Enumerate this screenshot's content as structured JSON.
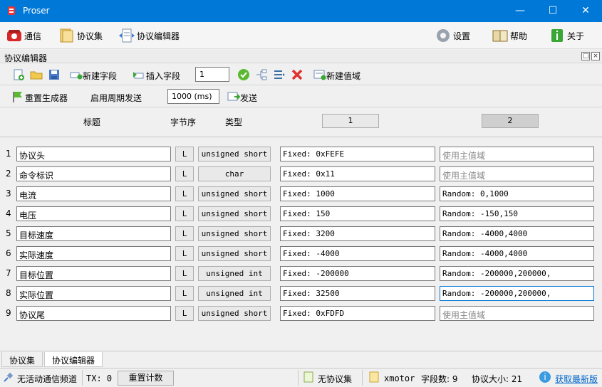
{
  "window": {
    "title": "Proser"
  },
  "toolbar": {
    "comm": "通信",
    "protocol_set": "协议集",
    "protocol_editor": "协议编辑器",
    "settings": "设置",
    "help": "帮助",
    "about": "关于"
  },
  "panel": {
    "title": "协议编辑器"
  },
  "editor_toolbar": {
    "new_field": "新建字段",
    "insert_field": "插入字段",
    "insert_count": "1",
    "new_value_domain": "新建值域"
  },
  "period_toolbar": {
    "reset_generator": "重置生成器",
    "enable_periodic": "启用周期发送",
    "period": "1000 (ms)",
    "send": "发送"
  },
  "columns": {
    "title": "标题",
    "byte_order": "字节序",
    "type": "类型",
    "domain1": "1",
    "domain2": "2"
  },
  "rows": [
    {
      "num": "1",
      "title": "协议头",
      "order": "L",
      "type": "unsigned short",
      "d1": "Fixed: 0xFEFE",
      "d2": "使用主值域",
      "d2_placeholder": true
    },
    {
      "num": "2",
      "title": "命令标识",
      "order": "L",
      "type": "char",
      "d1": "Fixed: 0x11",
      "d2": "使用主值域",
      "d2_placeholder": true
    },
    {
      "num": "3",
      "title": "电流",
      "order": "L",
      "type": "unsigned short",
      "d1": "Fixed: 1000",
      "d2": "Random: 0,1000",
      "d2_placeholder": false
    },
    {
      "num": "4",
      "title": "电压",
      "order": "L",
      "type": "unsigned short",
      "d1": "Fixed: 150",
      "d2": "Random: -150,150",
      "d2_placeholder": false
    },
    {
      "num": "5",
      "title": "目标速度",
      "order": "L",
      "type": "unsigned short",
      "d1": "Fixed: 3200",
      "d2": "Random: -4000,4000",
      "d2_placeholder": false
    },
    {
      "num": "6",
      "title": "实际速度",
      "order": "L",
      "type": "unsigned short",
      "d1": "Fixed: -4000",
      "d2": "Random: -4000,4000",
      "d2_placeholder": false
    },
    {
      "num": "7",
      "title": "目标位置",
      "order": "L",
      "type": "unsigned int",
      "d1": "Fixed: -200000",
      "d2": "Random: -200000,200000,",
      "d2_placeholder": false
    },
    {
      "num": "8",
      "title": "实际位置",
      "order": "L",
      "type": "unsigned int",
      "d1": "Fixed: 32500",
      "d2": "Random: -200000,200000,",
      "d2_placeholder": false
    },
    {
      "num": "9",
      "title": "协议尾",
      "order": "L",
      "type": "unsigned short",
      "d1": "Fixed: 0xFDFD",
      "d2": "使用主值域",
      "d2_placeholder": true
    }
  ],
  "tabs": {
    "protocol_set": "协议集",
    "protocol_editor": "协议编辑器"
  },
  "status": {
    "channel": "无活动通信频道",
    "tx": "TX: 0",
    "reset_count": "重置计数",
    "no_protocol_set": "无协议集",
    "file": "xmotor",
    "field_count": "字段数: 9",
    "protocol_size": "协议大小: 21",
    "get_latest": "获取最新版"
  },
  "colors": {
    "titlebar": "#0078d7",
    "link": "#0066cc"
  }
}
